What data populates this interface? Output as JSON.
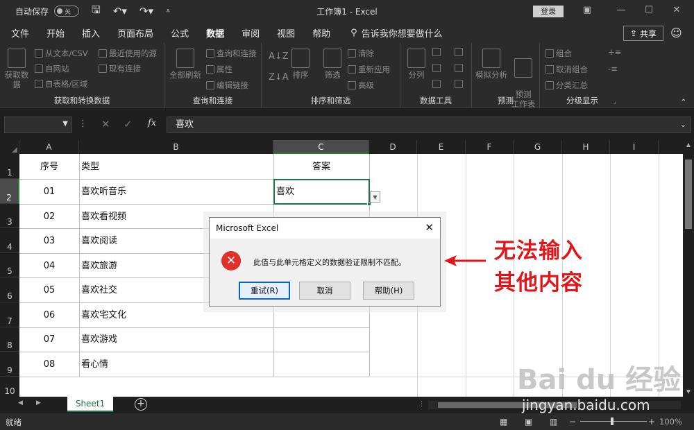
{
  "titlebar": {
    "autosave_label": "自动保存",
    "autosave_state": "关",
    "title": "工作簿1  -  Excel",
    "login": "登录"
  },
  "tabs": [
    "文件",
    "开始",
    "插入",
    "页面布局",
    "公式",
    "数据",
    "审阅",
    "视图",
    "帮助"
  ],
  "active_tab": "数据",
  "tell_me": "告诉我你想要做什么",
  "share": "共享",
  "ribbon": {
    "groups": {
      "get_transform": {
        "title": "获取和转换数据",
        "get_data": "获取数据",
        "from_text": "从文本/CSV",
        "from_web": "自网站",
        "from_table": "自表格/区域",
        "recent_sources": "最近使用的源",
        "existing_conn": "现有连接"
      },
      "queries": {
        "title": "查询和连接",
        "refresh_all": "全部刷新",
        "queries_conn": "查询和连接",
        "properties": "属性",
        "edit_links": "编辑链接"
      },
      "sort_filter": {
        "title": "排序和筛选",
        "sort": "排序",
        "filter": "筛选",
        "clear": "清除",
        "reapply": "重新应用",
        "advanced": "高级"
      },
      "data_tools": {
        "title": "数据工具",
        "split": "分列"
      },
      "forecast": {
        "title": "预测",
        "whatif": "模拟分析",
        "forecast_sheet": "预测\n工作表"
      },
      "outline": {
        "title": "分级显示",
        "group": "组合",
        "ungroup": "取消组合",
        "subtotal": "分类汇总"
      }
    }
  },
  "formula_bar": {
    "fx": "fx",
    "content": "喜欢"
  },
  "columns": [
    "A",
    "B",
    "C",
    "D",
    "E",
    "F",
    "G",
    "H",
    "I"
  ],
  "selected_column": "C",
  "rows": [
    "1",
    "2",
    "3",
    "4",
    "5",
    "6",
    "7",
    "8",
    "9",
    "10"
  ],
  "selected_row": "2",
  "table": {
    "header": [
      "序号",
      "类型",
      "答案"
    ],
    "rows": [
      [
        "01",
        "喜欢听音乐",
        "喜欢"
      ],
      [
        "02",
        "喜欢看视频",
        ""
      ],
      [
        "03",
        "喜欢阅读",
        ""
      ],
      [
        "04",
        "喜欢旅游",
        ""
      ],
      [
        "05",
        "喜欢社交",
        ""
      ],
      [
        "06",
        "喜欢宅文化",
        ""
      ],
      [
        "07",
        "喜欢游戏",
        ""
      ],
      [
        "08",
        "看心情",
        ""
      ]
    ]
  },
  "sheet_tab": "Sheet1",
  "status": {
    "ready": "就绪",
    "zoom": "100%"
  },
  "dialog": {
    "title": "Microsoft Excel",
    "message": "此值与此单元格定义的数据验证限制不匹配。",
    "buttons": [
      "重试(R)",
      "取消",
      "帮助(H)"
    ]
  },
  "annotation": {
    "line1": "无法输入",
    "line2": "其他内容",
    "color": "#e0161b"
  },
  "watermark": {
    "logo": "Bai du 经验",
    "url": "jingyan.baidu.com"
  },
  "colors": {
    "excel_green": "#217346",
    "error_red": "#e0302a"
  }
}
